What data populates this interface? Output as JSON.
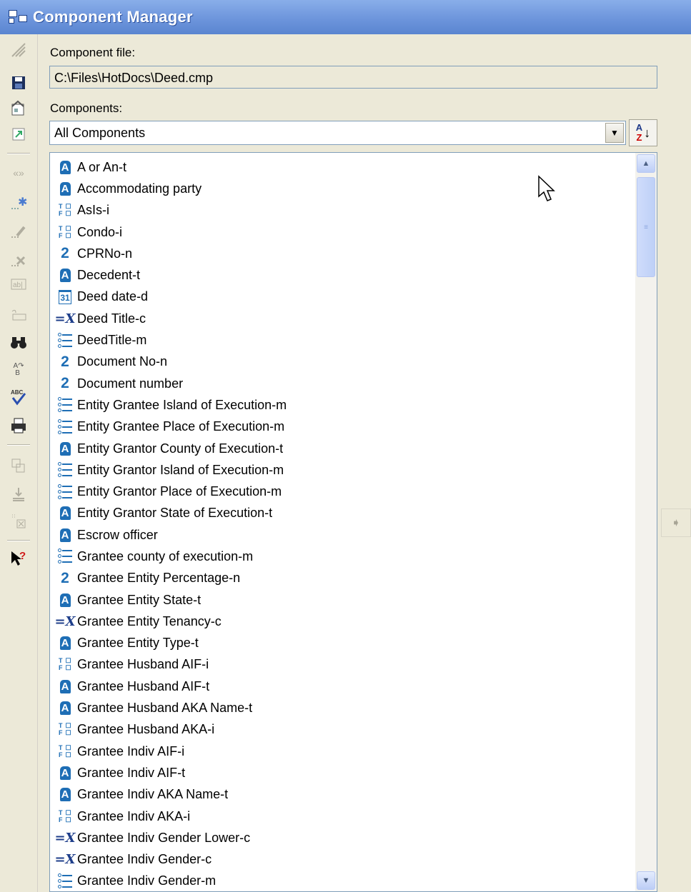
{
  "window": {
    "title": "Component Manager"
  },
  "toolbar": {
    "buttons": [
      {
        "icon": "pencil-lines-icon"
      },
      {
        "icon": "save-icon"
      },
      {
        "icon": "properties-icon"
      },
      {
        "icon": "open-icon"
      },
      {
        "icon": "brackets-icon"
      },
      {
        "icon": "new-component-icon"
      },
      {
        "icon": "edit-icon"
      },
      {
        "icon": "delete-icon"
      },
      {
        "icon": "text-field-icon"
      },
      {
        "icon": "script-icon"
      },
      {
        "icon": "binoculars-icon"
      },
      {
        "icon": "replace-icon"
      },
      {
        "icon": "spell-check-icon"
      },
      {
        "icon": "print-icon"
      },
      {
        "icon": "copy-icon"
      },
      {
        "icon": "paste-icon"
      },
      {
        "icon": "clear-icon"
      },
      {
        "icon": "help-pointer-icon"
      }
    ]
  },
  "component_file": {
    "label": "Component file:",
    "value": "C:\\Files\\HotDocs\\Deed.cmp"
  },
  "components": {
    "label": "Components:",
    "selected": "All Components",
    "sort_icon": "sort-az-icon"
  },
  "list": [
    {
      "type": "text",
      "name": "A or An-t"
    },
    {
      "type": "text",
      "name": "Accommodating party"
    },
    {
      "type": "truefalse",
      "name": "AsIs-i"
    },
    {
      "type": "truefalse",
      "name": "Condo-i"
    },
    {
      "type": "number",
      "name": "CPRNo-n"
    },
    {
      "type": "text",
      "name": "Decedent-t"
    },
    {
      "type": "date",
      "name": "Deed date-d"
    },
    {
      "type": "computation",
      "name": "Deed Title-c"
    },
    {
      "type": "multiple",
      "name": "DeedTitle-m"
    },
    {
      "type": "number",
      "name": "Document No-n"
    },
    {
      "type": "number",
      "name": "Document number"
    },
    {
      "type": "multiple",
      "name": "Entity Grantee Island of Execution-m"
    },
    {
      "type": "multiple",
      "name": "Entity Grantee Place of Execution-m"
    },
    {
      "type": "text",
      "name": "Entity Grantor County of Execution-t"
    },
    {
      "type": "multiple",
      "name": "Entity Grantor Island of Execution-m"
    },
    {
      "type": "multiple",
      "name": "Entity Grantor Place of Execution-m"
    },
    {
      "type": "text",
      "name": "Entity Grantor State of Execution-t"
    },
    {
      "type": "text",
      "name": "Escrow officer"
    },
    {
      "type": "multiple",
      "name": "Grantee county of execution-m"
    },
    {
      "type": "number",
      "name": "Grantee Entity Percentage-n"
    },
    {
      "type": "text",
      "name": "Grantee Entity State-t"
    },
    {
      "type": "computation",
      "name": "Grantee Entity Tenancy-c"
    },
    {
      "type": "text",
      "name": "Grantee Entity Type-t"
    },
    {
      "type": "truefalse",
      "name": "Grantee Husband AIF-i"
    },
    {
      "type": "text",
      "name": "Grantee Husband AIF-t"
    },
    {
      "type": "text",
      "name": "Grantee Husband AKA Name-t"
    },
    {
      "type": "truefalse",
      "name": "Grantee Husband AKA-i"
    },
    {
      "type": "truefalse",
      "name": "Grantee Indiv AIF-i"
    },
    {
      "type": "text",
      "name": "Grantee Indiv AIF-t"
    },
    {
      "type": "text",
      "name": "Grantee Indiv AKA Name-t"
    },
    {
      "type": "truefalse",
      "name": "Grantee Indiv AKA-i"
    },
    {
      "type": "computation",
      "name": "Grantee Indiv Gender Lower-c"
    },
    {
      "type": "computation",
      "name": "Grantee Indiv Gender-c"
    },
    {
      "type": "multiple",
      "name": "Grantee Indiv Gender-m"
    }
  ],
  "icons": {
    "text": "A",
    "number": "2",
    "date": "31",
    "computation": "=X"
  },
  "colors": {
    "accent": "#1e6eb5",
    "title_bar": "#6d95dc"
  }
}
